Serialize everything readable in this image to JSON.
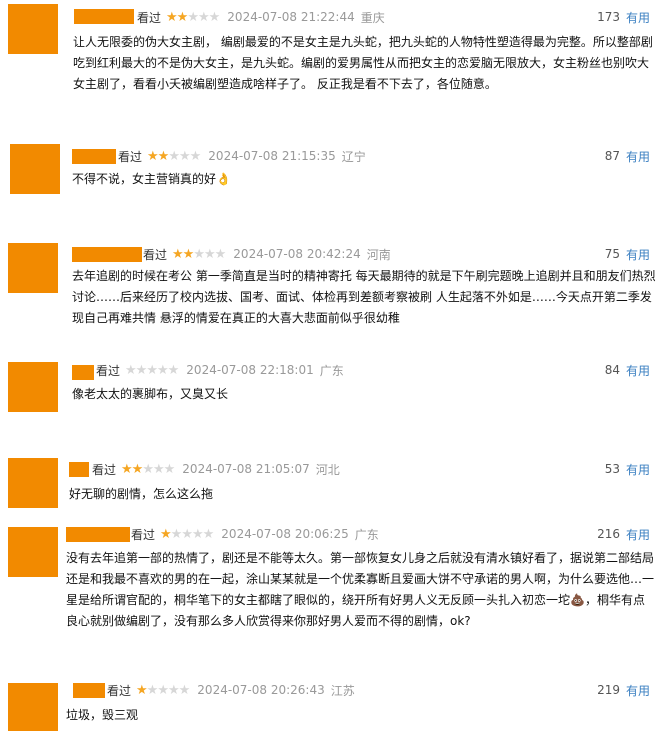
{
  "ui": {
    "seen_label": "看过",
    "useful_label": "有用",
    "avatar_color": "#f28a00",
    "star_color": "#f5a623",
    "link_color": "#3a7fc1"
  },
  "reviews": [
    {
      "rating": 2,
      "date": "2024-07-08 21:22:44",
      "location": "重庆",
      "useful_count": "173",
      "text": "让人无限委的伪大女主剧， 编剧最爱的不是女主是九头蛇，把九头蛇的人物特性塑造得最为完整。所以整部剧吃到红利最大的不是伪大女主，是九头蛇。编剧的爱男属性从而把女主的恋爱脑无限放大，女主粉丝也别吹大女主剧了，看看小夭被编剧塑造成啥样子了。 反正我是看不下去了，各位随意。"
    },
    {
      "rating": 2,
      "date": "2024-07-08 21:15:35",
      "location": "辽宁",
      "useful_count": "87",
      "text": "不得不说，女主营销真的好👌"
    },
    {
      "rating": 2,
      "date": "2024-07-08 20:42:24",
      "location": "河南",
      "useful_count": "75",
      "text": "去年追剧的时候在考公 第一季简直是当时的精神寄托 每天最期待的就是下午刷完题晚上追剧并且和朋友们热烈讨论……后来经历了校内选拔、国考、面试、体检再到差额考察被刷 人生起落不外如是……今天点开第二季发现自己再难共情 悬浮的情爱在真正的大喜大悲面前似乎很幼稚"
    },
    {
      "rating": 0,
      "date": "2024-07-08 22:18:01",
      "location": "广东",
      "useful_count": "84",
      "text": "像老太太的裹脚布，又臭又长"
    },
    {
      "rating": 2,
      "date": "2024-07-08 21:05:07",
      "location": "河北",
      "useful_count": "53",
      "text": "好无聊的剧情，怎么这么拖"
    },
    {
      "rating": 1,
      "date": "2024-07-08 20:06:25",
      "location": "广东",
      "useful_count": "216",
      "text": "没有去年追第一部的热情了，剧还是不能等太久。第一部恢复女儿身之后就没有清水镇好看了，据说第二部结局还是和我最不喜欢的男的在一起，涂山某某就是一个优柔寡断且爱画大饼不守承诺的男人啊，为什么要选他…一星是给所谓官配的，桐华笔下的女主都瞎了眼似的，绕开所有好男人义无反顾一头扎入初恋一坨💩，桐华有点良心就别做编剧了，没有那么多人欣赏得来你那好男人爱而不得的剧情，ok?"
    },
    {
      "rating": 1,
      "date": "2024-07-08 20:26:43",
      "location": "江苏",
      "useful_count": "219",
      "text": "垃圾，毁三观"
    }
  ]
}
